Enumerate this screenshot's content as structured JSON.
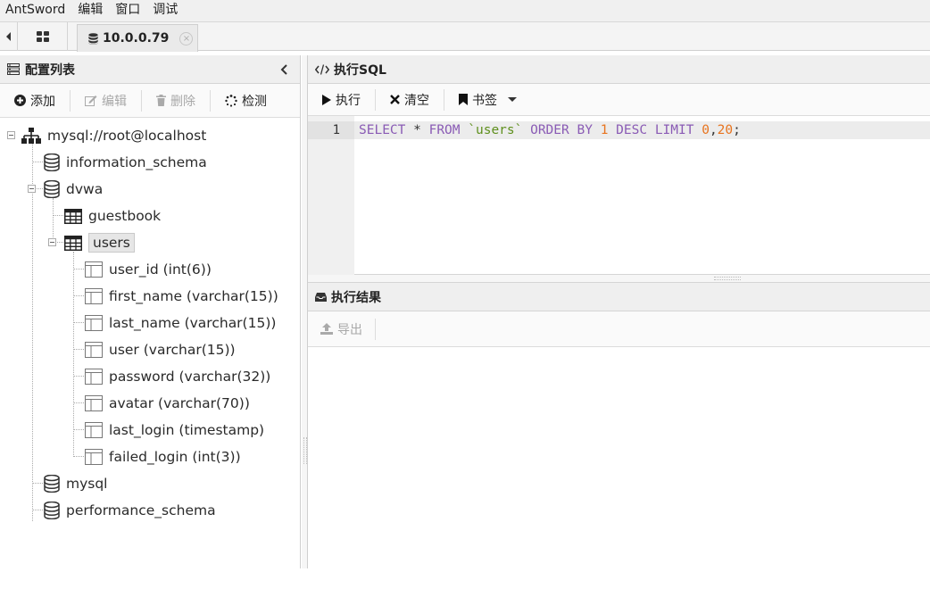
{
  "menu": [
    "AntSword",
    "编辑",
    "窗口",
    "调试"
  ],
  "tabs": {
    "active_label": "10.0.0.79",
    "close_glyph": "×"
  },
  "left_panel": {
    "title": "配置列表",
    "toolbar": {
      "add": "添加",
      "edit": "编辑",
      "delete": "删除",
      "detect": "检测"
    }
  },
  "tree": {
    "root": "mysql://root@localhost",
    "databases": [
      {
        "name": "information_schema"
      },
      {
        "name": "dvwa",
        "tables": [
          {
            "name": "guestbook"
          },
          {
            "name": "users",
            "selected": true,
            "columns": [
              "user_id (int(6))",
              "first_name (varchar(15))",
              "last_name (varchar(15))",
              "user (varchar(15))",
              "password (varchar(32))",
              "avatar (varchar(70))",
              "last_login (timestamp)",
              "failed_login (int(3))"
            ]
          }
        ]
      },
      {
        "name": "mysql"
      },
      {
        "name": "performance_schema"
      }
    ]
  },
  "right_panel": {
    "title": "执行SQL",
    "toolbar": {
      "execute": "执行",
      "clear": "清空",
      "bookmarks": "书签"
    },
    "editor": {
      "line_number": "1",
      "sql": "SELECT * FROM `users` ORDER BY 1 DESC LIMIT 0,20;"
    },
    "results": {
      "title": "执行结果",
      "export": "导出"
    }
  },
  "colors": {
    "keyword": "#8a5bb5",
    "string": "#5e8f1d",
    "number": "#e8741f"
  }
}
